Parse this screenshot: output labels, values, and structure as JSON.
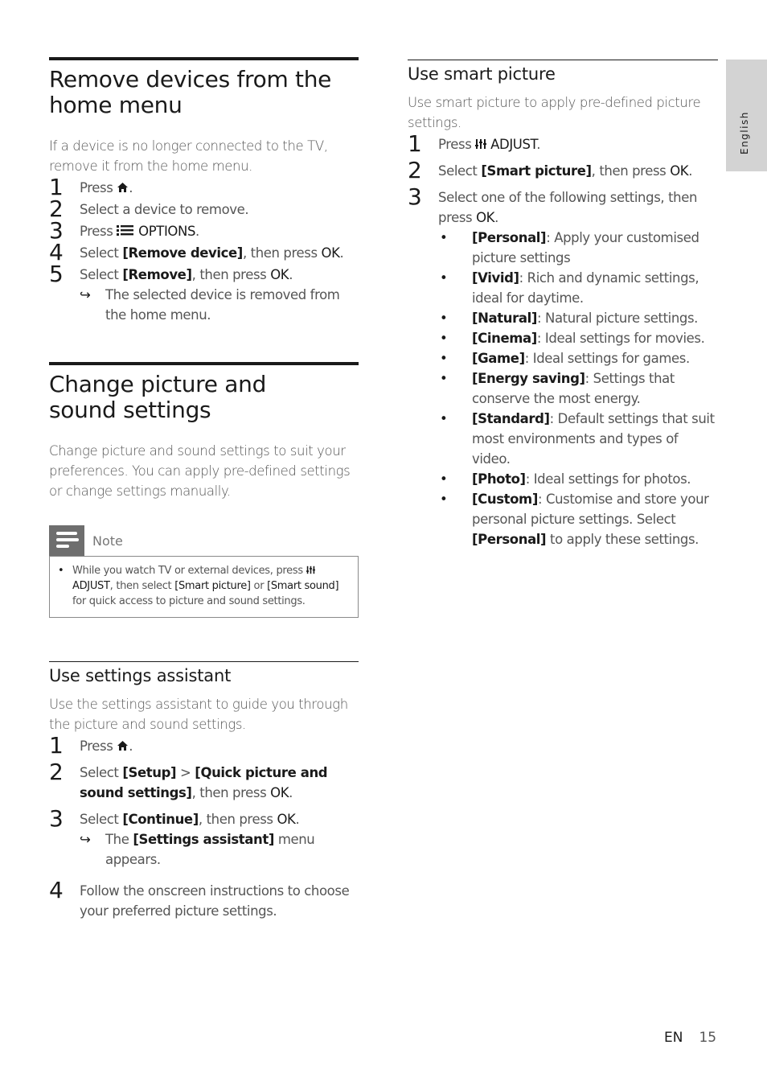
{
  "sections": {
    "remove": {
      "title": "Remove devices from the home menu",
      "intro": "If a device is no longer connected to the TV, remove it from the home menu.",
      "steps": [
        {
          "num": "1",
          "pre": "Press ",
          "icon": "home-icon",
          "post": "."
        },
        {
          "num": "2",
          "text": "Select a device to remove."
        },
        {
          "num": "3",
          "pre": "Press ",
          "icon": "options-icon",
          "bold": "OPTIONS",
          "post": "."
        },
        {
          "num": "4",
          "pre": "Select ",
          "bold": "[Remove device]",
          "mid": ", then press ",
          "bold2": "OK",
          "post": "."
        },
        {
          "num": "5",
          "pre": "Select ",
          "bold": "[Remove]",
          "mid": ", then press ",
          "bold2": "OK",
          "post": "."
        }
      ],
      "result": "The selected device is removed from the home menu.",
      "result_arrow": "↪"
    },
    "change": {
      "title": "Change picture and sound settings",
      "intro": "Change picture and sound settings to suit your preferences. You can apply pre-defined settings or change settings manually.",
      "note": {
        "label": "Note",
        "pre": "While you watch TV or external devices, press ",
        "adjust": "ADJUST",
        "mid": ", then select ",
        "opt1": "[Smart picture]",
        "or": " or ",
        "opt2": "[Smart sound]",
        "post": " for quick access to picture and sound settings."
      }
    },
    "assistant": {
      "title": "Use settings assistant",
      "intro": "Use the settings assistant to guide you through the picture and sound settings.",
      "steps": [
        {
          "num": "1",
          "pre": "Press ",
          "post": "."
        },
        {
          "num": "2",
          "pre": "Select ",
          "bold": "[Setup]",
          "sep": " > ",
          "bold2": "[Quick picture and sound settings]",
          "mid": ", then press ",
          "bold3": "OK",
          "post": "."
        },
        {
          "num": "3",
          "pre": "Select ",
          "bold": "[Continue]",
          "mid": ", then press ",
          "bold2": "OK",
          "post": "."
        },
        {
          "num": "4",
          "text": "Follow the onscreen instructions to choose your preferred picture settings."
        }
      ],
      "result_pre": "The ",
      "result_bold": "[Settings assistant]",
      "result_post": " menu appears.",
      "result_arrow": "↪"
    },
    "smart": {
      "title": "Use smart picture",
      "intro": "Use smart picture to apply pre-defined picture settings.",
      "steps": [
        {
          "num": "1",
          "pre": "Press ",
          "bold": "ADJUST",
          "post": "."
        },
        {
          "num": "2",
          "pre": "Select ",
          "bold": "[Smart picture]",
          "mid": ", then press ",
          "bold2": "OK",
          "post": "."
        },
        {
          "num": "3",
          "pre": "Select one of the following settings, then press ",
          "bold": "OK",
          "post": "."
        }
      ],
      "options": [
        {
          "name": "[Personal]",
          "desc": ": Apply your customised picture settings"
        },
        {
          "name": "[Vivid]",
          "desc": ": Rich and dynamic settings, ideal for daytime."
        },
        {
          "name": "[Natural]",
          "desc": ": Natural picture settings."
        },
        {
          "name": "[Cinema]",
          "desc": ": Ideal settings for movies."
        },
        {
          "name": "[Game]",
          "desc": ": Ideal settings for games."
        },
        {
          "name": "[Energy saving]",
          "desc": ": Settings that conserve the most energy."
        },
        {
          "name": "[Standard]",
          "desc": ": Default settings that suit most environments and types of video."
        },
        {
          "name": "[Photo]",
          "desc": ": Ideal settings for photos."
        },
        {
          "name": "[Custom]",
          "desc": ": Customise and store your personal picture settings. Select ",
          "bold": "[Personal]",
          "post": " to apply these settings."
        }
      ],
      "bullet": "•"
    }
  },
  "side_tab": "English",
  "footer": {
    "lang": "EN",
    "page": "15"
  }
}
